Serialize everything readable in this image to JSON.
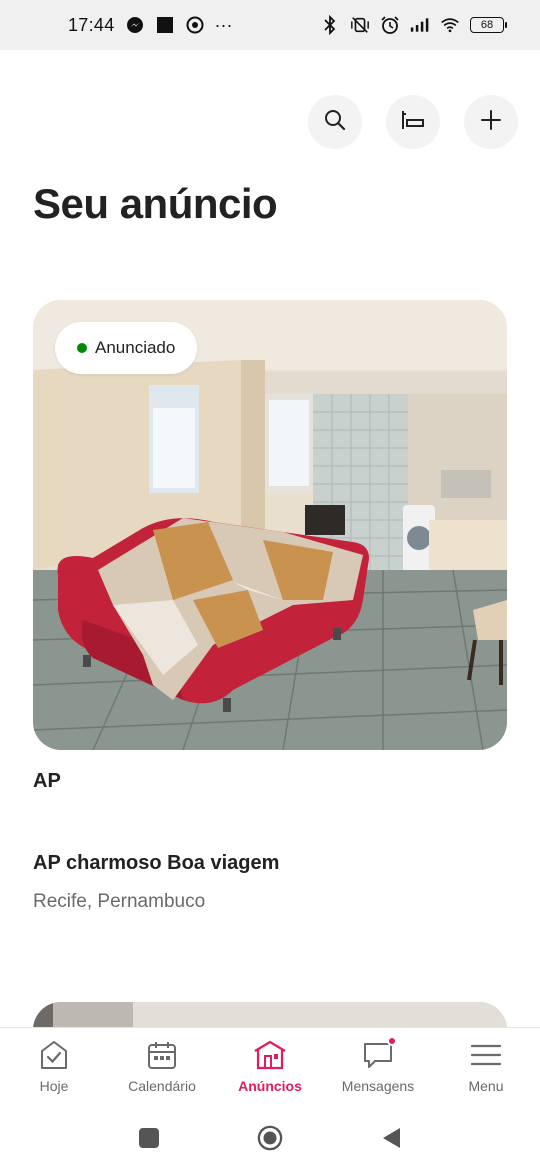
{
  "status_bar": {
    "time": "17:44",
    "more": "···",
    "battery": "68",
    "left_icons": [
      "messenger-icon",
      "square-app-icon",
      "chrome-icon"
    ],
    "right_icons": [
      "bluetooth-icon",
      "vibrate-off-icon",
      "alarm-icon",
      "signal-icon",
      "wifi-icon",
      "battery-icon"
    ]
  },
  "header": {
    "title": "Seu anúncio",
    "actions": [
      "search-icon",
      "bed-icon",
      "plus-icon"
    ]
  },
  "listing": {
    "status": "Anunciado",
    "status_color": "#008a05",
    "name": "AP",
    "title": "AP charmoso Boa viagem",
    "location": "Recife, Pernambuco"
  },
  "tabs": [
    {
      "label": "Hoje",
      "icon": "today-check-icon"
    },
    {
      "label": "Calendário",
      "icon": "calendar-icon"
    },
    {
      "label": "Anúncios",
      "icon": "listings-house-icon",
      "active": true
    },
    {
      "label": "Mensagens",
      "icon": "chat-icon",
      "badge": true
    },
    {
      "label": "Menu",
      "icon": "hamburger-icon"
    }
  ],
  "colors": {
    "accent": "#e31c5f",
    "muted_text": "#6a6a6a",
    "text": "#222222"
  }
}
